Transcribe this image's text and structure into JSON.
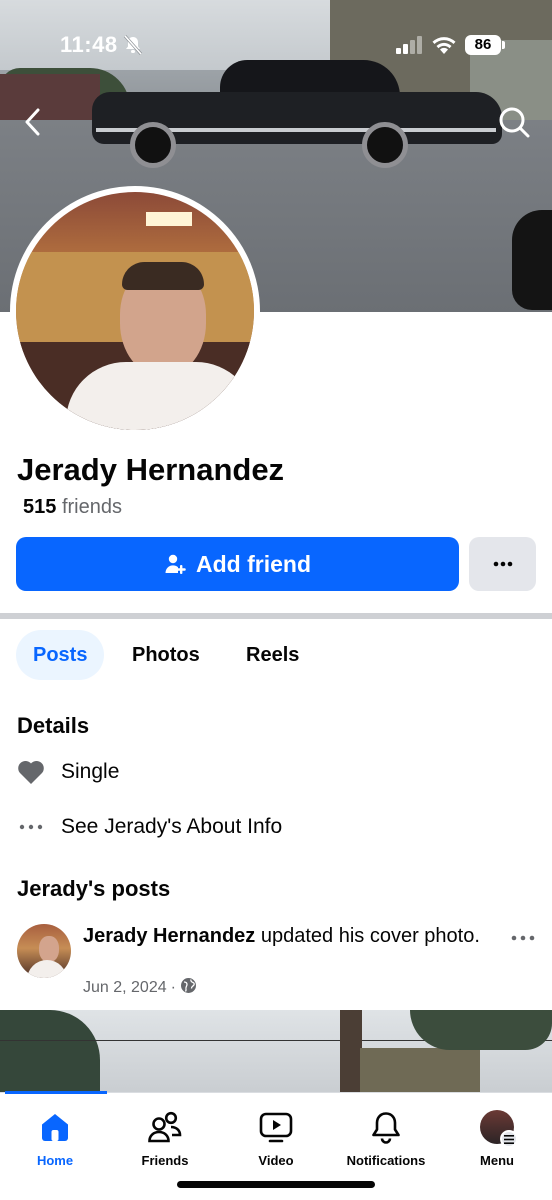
{
  "status_bar": {
    "time": "11:48",
    "battery": "86"
  },
  "profile": {
    "name": "Jerady Hernandez",
    "friends_number": "515",
    "friends_label": "friends",
    "add_friend_label": "Add friend"
  },
  "tabs": [
    {
      "label": "Posts",
      "active": true
    },
    {
      "label": "Photos",
      "active": false
    },
    {
      "label": "Reels",
      "active": false
    }
  ],
  "details": {
    "title": "Details",
    "relationship": "Single",
    "about_link": "See Jerady's About Info"
  },
  "posts_section": {
    "title": "Jerady's posts"
  },
  "post": {
    "author": "Jerady Hernandez",
    "action": " updated his cover photo.",
    "date": "Jun 2, 2024",
    "separator": "·"
  },
  "bottom_nav": [
    {
      "label": "Home",
      "icon": "home-icon",
      "active": true
    },
    {
      "label": "Friends",
      "icon": "friends-icon",
      "active": false
    },
    {
      "label": "Video",
      "icon": "video-icon",
      "active": false
    },
    {
      "label": "Notifications",
      "icon": "bell-icon",
      "active": false
    },
    {
      "label": "Menu",
      "icon": "profile-menu-icon",
      "active": false
    }
  ],
  "colors": {
    "accent": "#0866ff",
    "secondary_text": "#65676b",
    "secondary_button": "#e4e6eb",
    "active_tab_bg": "#ebf5ff"
  }
}
